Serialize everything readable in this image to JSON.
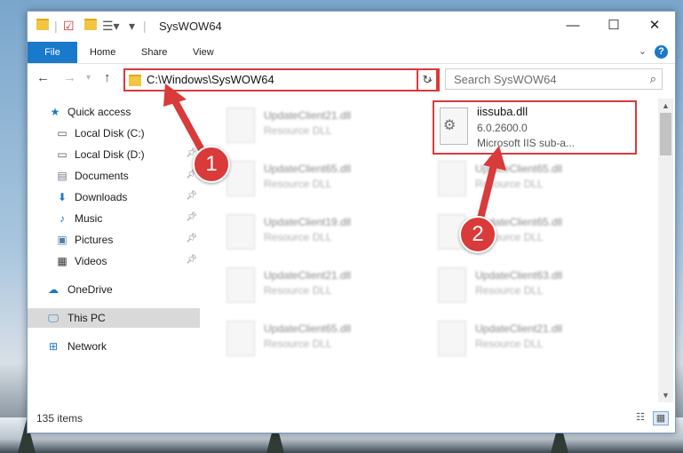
{
  "window": {
    "title": "SysWOW64"
  },
  "ribbon": {
    "tabs": [
      "File",
      "Home",
      "Share",
      "View"
    ],
    "help": "?"
  },
  "navigation": {
    "address": "C:\\Windows\\SysWOW64",
    "search_placeholder": "Search SysWOW64"
  },
  "sidebar": {
    "items": [
      {
        "label": "Quick access",
        "icon": "star-icon"
      },
      {
        "label": "Local Disk (C:)",
        "icon": "drive-icon"
      },
      {
        "label": "Local Disk (D:)",
        "icon": "drive-icon"
      },
      {
        "label": "Documents",
        "icon": "document-icon"
      },
      {
        "label": "Downloads",
        "icon": "download-icon"
      },
      {
        "label": "Music",
        "icon": "music-icon"
      },
      {
        "label": "Pictures",
        "icon": "picture-icon"
      },
      {
        "label": "Videos",
        "icon": "video-icon"
      },
      {
        "label": "OneDrive",
        "icon": "cloud-icon"
      },
      {
        "label": "This PC",
        "icon": "computer-icon"
      },
      {
        "label": "Network",
        "icon": "network-icon"
      }
    ]
  },
  "files": [
    {
      "name": "UpdateClient21.dll",
      "type": "Resource DLL"
    },
    {
      "name": "UpdateClient65.dll",
      "type": "Resource DLL"
    },
    {
      "name": "UpdateClient65.dll",
      "type": "Resource DLL"
    },
    {
      "name": "UpdateClient19.dll",
      "type": "Resource DLL"
    },
    {
      "name": "UpdateClient65.dll",
      "type": "Resource DLL"
    },
    {
      "name": "UpdateClient21.dll",
      "type": "Resource DLL"
    },
    {
      "name": "UpdateClient63.dll",
      "type": "Resource DLL"
    },
    {
      "name": "UpdateClient65.dll",
      "type": "Resource DLL"
    },
    {
      "name": "UpdateClient21.dll",
      "type": "Resource DLL"
    }
  ],
  "highlighted_file": {
    "name": "iissuba.dll",
    "version": "6.0.2600.0",
    "description": "Microsoft IIS sub-a..."
  },
  "status": {
    "item_count": "135 items"
  },
  "annotations": {
    "step1": "1",
    "step2": "2"
  },
  "colors": {
    "accent": "#1979ca",
    "highlight": "#d93a3a"
  }
}
